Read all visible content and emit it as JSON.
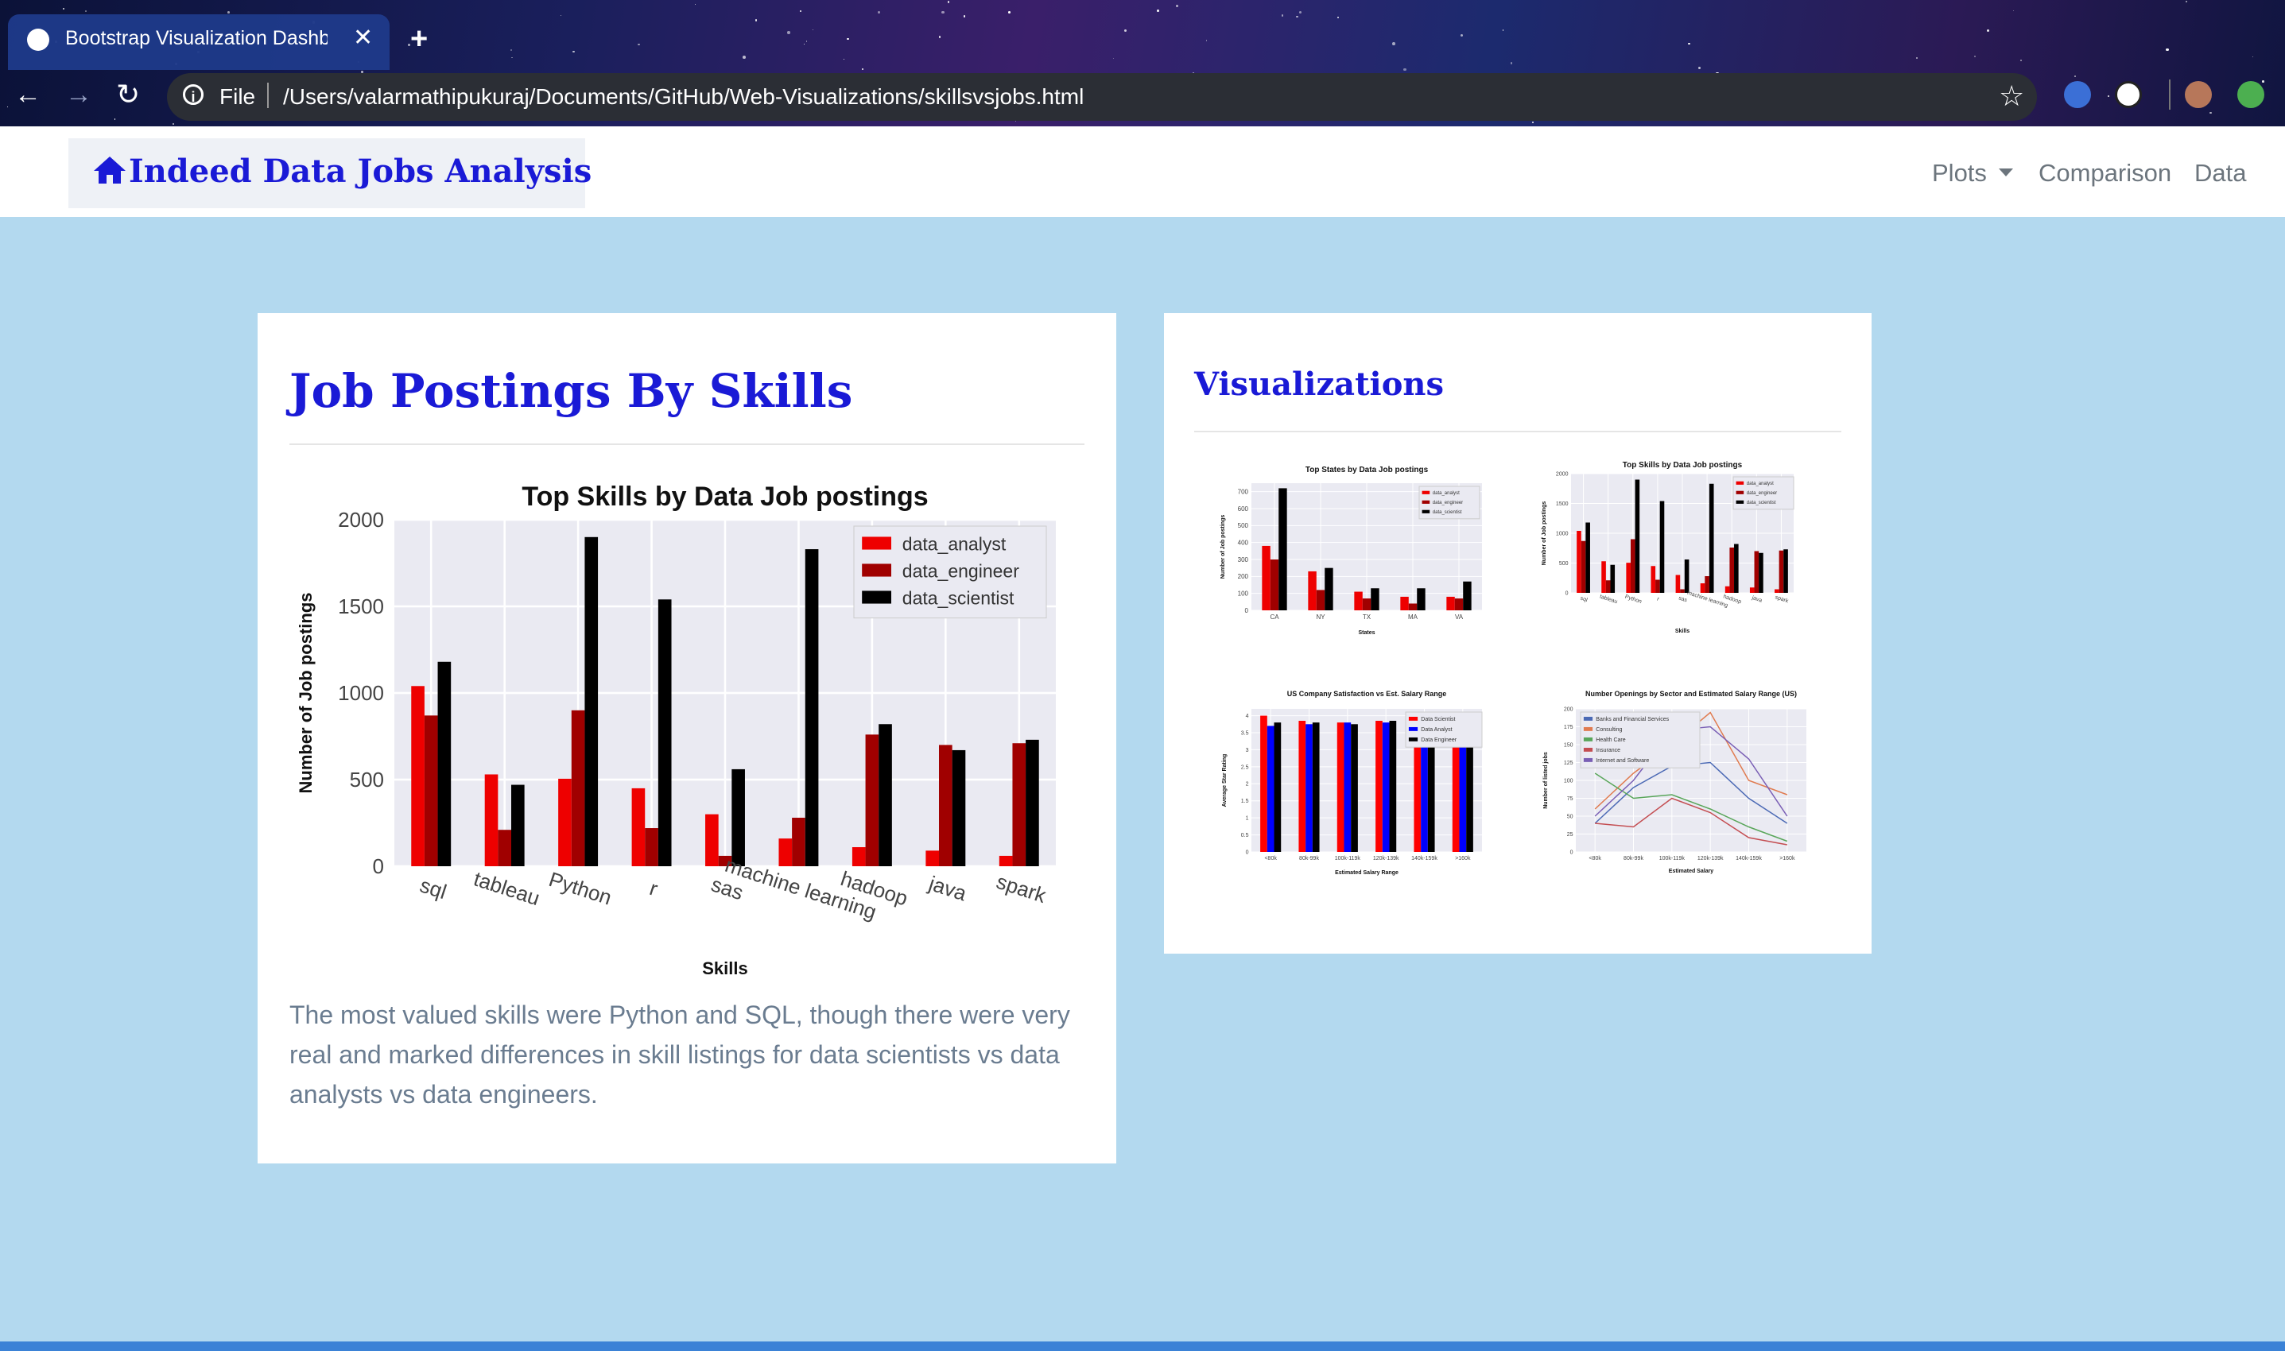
{
  "browser": {
    "tab_title": "Bootstrap Visualization Dashbo",
    "file_label": "File",
    "url": "/Users/valarmathipukuraj/Documents/GitHub/Web-Visualizations/skillsvsjobs.html"
  },
  "navbar": {
    "brand": "Indeed Data Jobs Analysis",
    "links": {
      "plots": "Plots",
      "comparison": "Comparison",
      "data": "Data"
    }
  },
  "main_card": {
    "title": "Job Postings By Skills",
    "description": "The most valued skills were Python and SQL, though there were very real and marked differences in skill listings for data scientists vs data analysts vs data engineers."
  },
  "side_card": {
    "title": "Visualizations"
  },
  "colors": {
    "analyst": "#ee0000",
    "engineer": "#a00000",
    "scientist": "#000000",
    "brand": "#1a1ad6"
  },
  "chart_data": [
    {
      "type": "bar",
      "title": "Top Skills by Data Job postings",
      "xlabel": "Skills",
      "ylabel": "Number of Job postings",
      "ylim": [
        0,
        2000
      ],
      "yticks": [
        0,
        500,
        1000,
        1500,
        2000
      ],
      "categories": [
        "sql",
        "tableau",
        "Python",
        "r",
        "sas",
        "machine learning",
        "hadoop",
        "java",
        "spark"
      ],
      "series": [
        {
          "name": "data_analyst",
          "values": [
            1040,
            530,
            505,
            450,
            300,
            160,
            110,
            90,
            60
          ]
        },
        {
          "name": "data_engineer",
          "values": [
            870,
            210,
            900,
            220,
            60,
            280,
            760,
            700,
            710
          ]
        },
        {
          "name": "data_scientist",
          "values": [
            1180,
            470,
            1900,
            1540,
            560,
            1830,
            820,
            670,
            730
          ]
        }
      ],
      "legend": "top-right",
      "grid": true
    },
    {
      "type": "bar",
      "title": "Top States by Data Job postings",
      "xlabel": "States",
      "ylabel": "Number of Job postings",
      "ylim": [
        0,
        750
      ],
      "yticks": [
        0,
        100,
        200,
        300,
        400,
        500,
        600,
        700
      ],
      "categories": [
        "CA",
        "NY",
        "TX",
        "MA",
        "VA"
      ],
      "series": [
        {
          "name": "data_analyst",
          "values": [
            380,
            230,
            110,
            80,
            80
          ]
        },
        {
          "name": "data_engineer",
          "values": [
            300,
            120,
            70,
            40,
            70
          ]
        },
        {
          "name": "data_scientist",
          "values": [
            720,
            250,
            130,
            130,
            170
          ]
        }
      ]
    },
    {
      "type": "bar",
      "title": "Top Skills by Data Job postings",
      "xlabel": "Skills",
      "ylabel": "Number of Job postings",
      "ylim": [
        0,
        2000
      ],
      "yticks": [
        0,
        500,
        1000,
        1500,
        2000
      ],
      "categories": [
        "sql",
        "tableau",
        "Python",
        "r",
        "sas",
        "machine learning",
        "hadoop",
        "java",
        "spark"
      ],
      "series": [
        {
          "name": "data_analyst",
          "values": [
            1040,
            530,
            505,
            450,
            300,
            160,
            110,
            90,
            60
          ]
        },
        {
          "name": "data_engineer",
          "values": [
            870,
            210,
            900,
            220,
            60,
            280,
            760,
            700,
            710
          ]
        },
        {
          "name": "data_scientist",
          "values": [
            1180,
            470,
            1900,
            1540,
            560,
            1830,
            820,
            670,
            730
          ]
        }
      ]
    },
    {
      "type": "bar",
      "title": "US Company Satisfaction vs Est. Salary Range",
      "xlabel": "Estimated Salary Range",
      "ylabel": "Average Star Rating",
      "ylim": [
        0,
        4.2
      ],
      "yticks": [
        0.0,
        0.5,
        1.0,
        1.5,
        2.0,
        2.5,
        3.0,
        3.5,
        4.0
      ],
      "categories": [
        "<80k",
        "80k-99k",
        "100k-119k",
        "120k-139k",
        "140k-159k",
        ">160k"
      ],
      "series": [
        {
          "name": "Data Scientist",
          "values": [
            4.0,
            3.85,
            3.8,
            3.85,
            3.85,
            3.85
          ]
        },
        {
          "name": "Data Analyst",
          "values": [
            3.7,
            3.75,
            3.8,
            3.8,
            3.8,
            3.8
          ]
        },
        {
          "name": "Data Engineer",
          "values": [
            3.8,
            3.8,
            3.75,
            3.85,
            3.8,
            3.8
          ]
        }
      ]
    },
    {
      "type": "line",
      "title": "Number Openings by Sector and Estimated Salary Range (US)",
      "xlabel": "Estimated Salary",
      "ylabel": "Number of listed jobs",
      "ylim": [
        0,
        200
      ],
      "yticks": [
        0,
        25,
        50,
        75,
        100,
        125,
        150,
        175,
        200
      ],
      "categories": [
        "<80k",
        "80k-99k",
        "100k-119k",
        "120k-139k",
        "140k-159k",
        ">160k"
      ],
      "series": [
        {
          "name": "Banks and Financial Services",
          "values": [
            40,
            90,
            120,
            125,
            75,
            40
          ]
        },
        {
          "name": "Consulting",
          "values": [
            60,
            110,
            150,
            195,
            100,
            80
          ]
        },
        {
          "name": "Health Care",
          "values": [
            110,
            75,
            80,
            60,
            35,
            15
          ]
        },
        {
          "name": "Insurance",
          "values": [
            40,
            35,
            75,
            55,
            20,
            10
          ]
        },
        {
          "name": "Internet and Software",
          "values": [
            50,
            100,
            170,
            175,
            130,
            50
          ]
        }
      ]
    }
  ]
}
